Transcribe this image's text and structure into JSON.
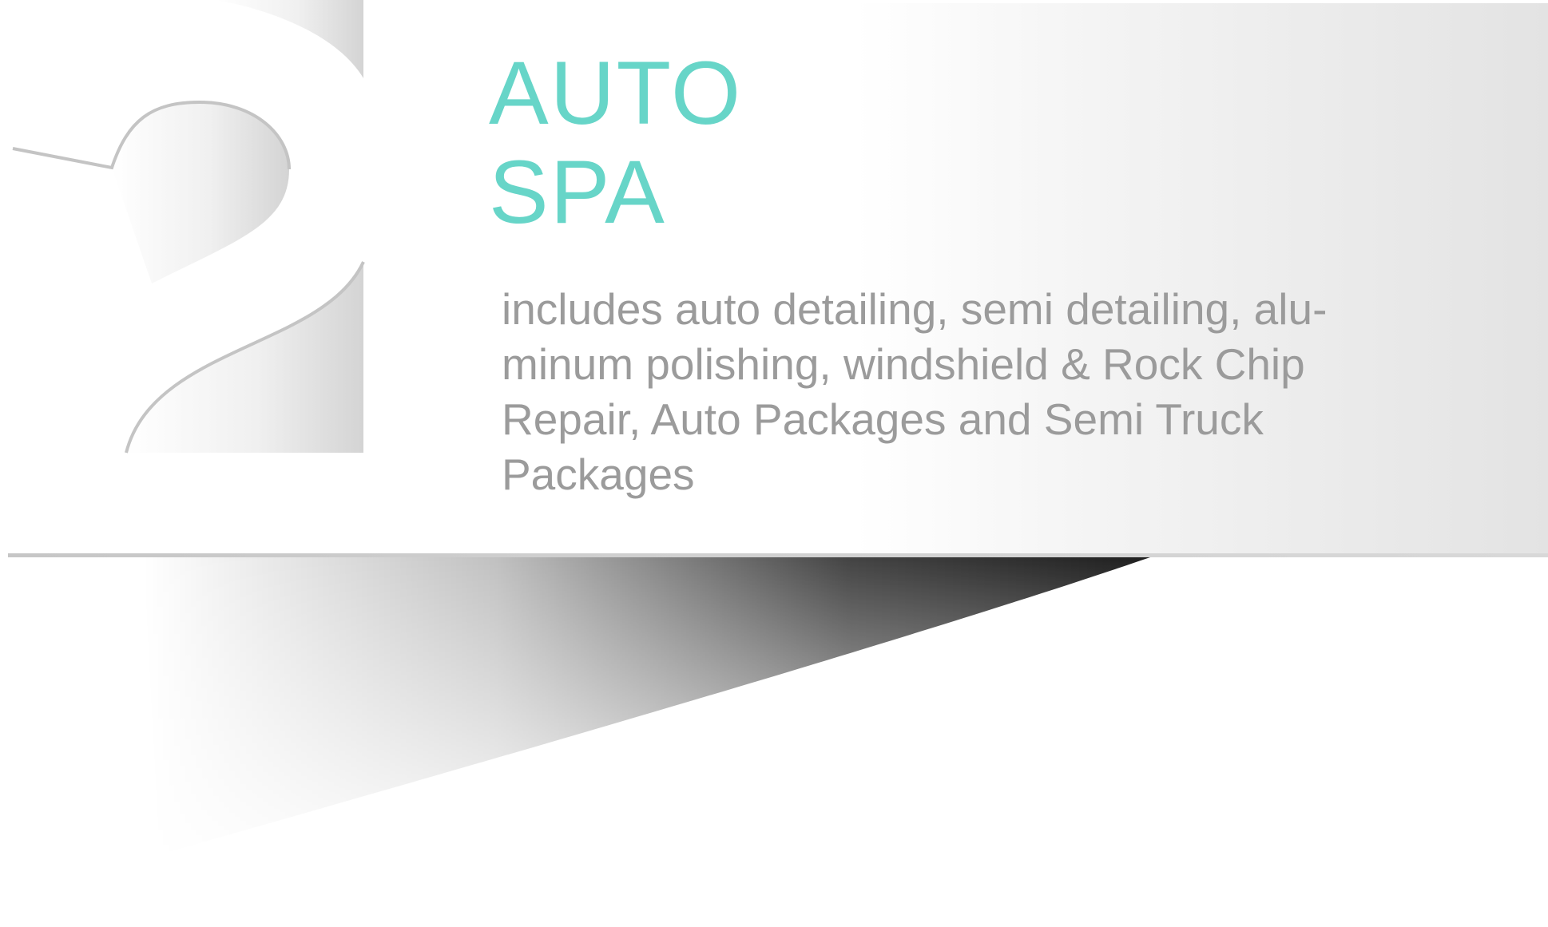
{
  "feature": {
    "number": "2",
    "title_line1": "AUTO",
    "title_line2": "SPA",
    "description": "includes auto detailing, semi detailing, alu-minum polishing, windshield & Rock Chip Repair, Auto Packages and Semi Truck Packages"
  },
  "colors": {
    "accent": "#67d5c8",
    "body_text": "#9b9b9b"
  }
}
